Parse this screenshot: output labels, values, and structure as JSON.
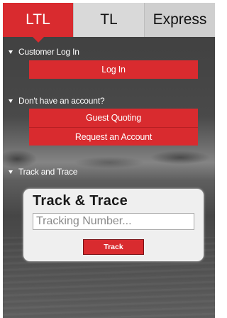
{
  "tabs": [
    {
      "label": "LTL",
      "active": true
    },
    {
      "label": "TL",
      "active": false
    },
    {
      "label": "Express",
      "active": false
    }
  ],
  "sections": {
    "customer_login": {
      "heading": "Customer Log In",
      "button": "Log In"
    },
    "no_account": {
      "heading": "Don't have an account?",
      "guest_button": "Guest Quoting",
      "request_button": "Request an Account"
    },
    "track_and_trace": {
      "heading": "Track and Trace"
    }
  },
  "track_card": {
    "title": "Track & Trace",
    "placeholder": "Tracking Number...",
    "button": "Track"
  },
  "colors": {
    "accent": "#d92b2f",
    "tab_inactive": "#d9d9d9",
    "card_bg": "#efefef"
  },
  "icons": {
    "section_toggle": "chevron-down-icon"
  }
}
